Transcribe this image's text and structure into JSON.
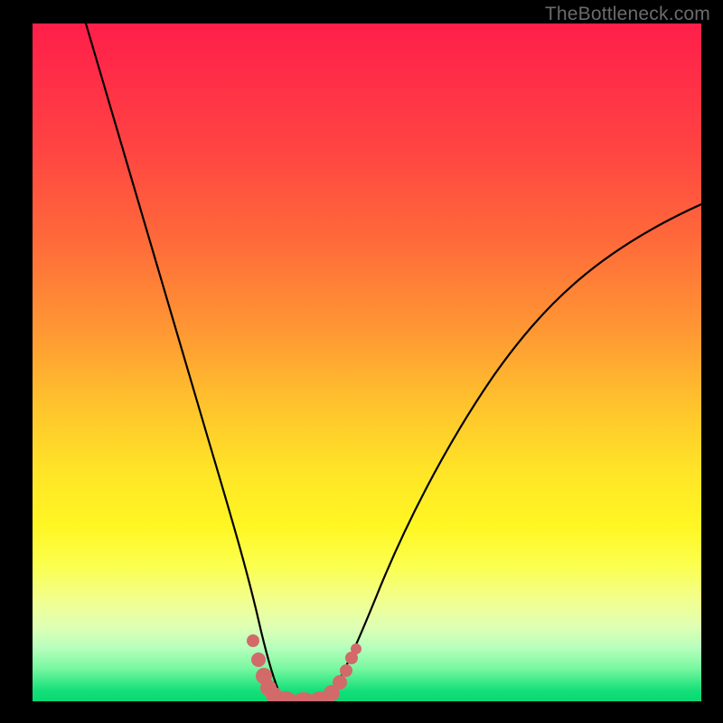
{
  "watermark": "TheBottleneck.com",
  "colors": {
    "frame": "#000000",
    "curve": "#000000",
    "marker": "#d26a6a",
    "gradient_top": "#ff1f4a",
    "gradient_bottom": "#08d971"
  },
  "chart_data": {
    "type": "line",
    "title": "",
    "xlabel": "",
    "ylabel": "",
    "xlim": [
      0,
      100
    ],
    "ylim": [
      0,
      100
    ],
    "grid": false,
    "legend": false,
    "series": [
      {
        "name": "bottleneck-curve",
        "note": "V-shaped curve. x in [0,100], y in [0,100]. Points estimated from pixel positions; y=0 is bottom (green), y=100 is top (red). No axis ticks or numbers are shown in the image; all values are visual estimates.",
        "x": [
          8,
          12,
          16,
          20,
          24,
          28,
          30,
          32,
          33.5,
          34.8,
          36,
          37,
          38,
          40,
          42,
          44,
          46,
          48,
          50,
          55,
          60,
          65,
          70,
          75,
          80,
          85,
          90,
          95,
          100
        ],
        "y": [
          100,
          88,
          76,
          63,
          49,
          33,
          24,
          14,
          7,
          3,
          0.5,
          0,
          0,
          0,
          0,
          0.5,
          2.5,
          6,
          10,
          20,
          29,
          37,
          44,
          50,
          55,
          60,
          64,
          68,
          71
        ]
      }
    ],
    "markers": {
      "name": "valley-markers",
      "note": "Salmon rounded markers clustered around the valley floor, lying on the curve.",
      "points": [
        {
          "x": 33.0,
          "y": 9
        },
        {
          "x": 33.8,
          "y": 6
        },
        {
          "x": 34.5,
          "y": 3.5
        },
        {
          "x": 35.2,
          "y": 1.8
        },
        {
          "x": 36.0,
          "y": 0.8
        },
        {
          "x": 37.5,
          "y": 0.3
        },
        {
          "x": 39.0,
          "y": 0.2
        },
        {
          "x": 40.5,
          "y": 0.2
        },
        {
          "x": 42.0,
          "y": 0.3
        },
        {
          "x": 43.5,
          "y": 0.8
        },
        {
          "x": 45.3,
          "y": 2.2
        },
        {
          "x": 46.2,
          "y": 3.5
        },
        {
          "x": 47.3,
          "y": 5.5
        },
        {
          "x": 48.3,
          "y": 7.5
        }
      ]
    }
  }
}
